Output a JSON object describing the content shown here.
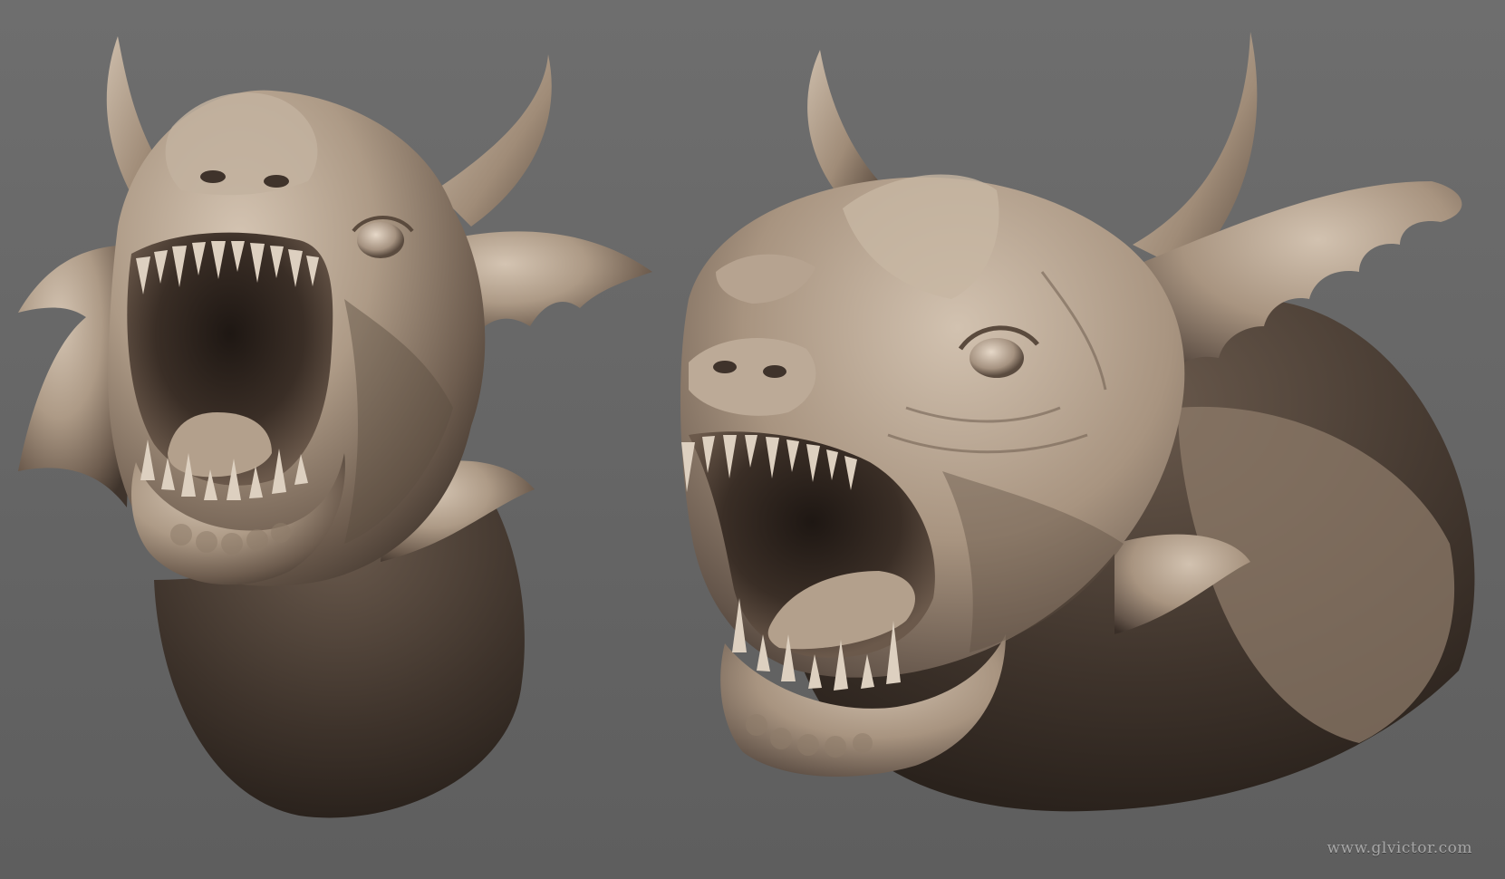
{
  "watermark": {
    "text": "www.glvictor.com"
  },
  "colors": {
    "background_top": "#6d6d6d",
    "background_bottom": "#5f5f5f",
    "clay_light": "#c9b9a8",
    "clay_mid": "#9c8a78",
    "clay_dark": "#4a3d33",
    "mouth_dark": "#2a211c",
    "teeth": "#ddd0c0"
  },
  "figures": [
    {
      "name": "dragon-head-front-view"
    },
    {
      "name": "dragon-head-three-quarter-view"
    }
  ]
}
